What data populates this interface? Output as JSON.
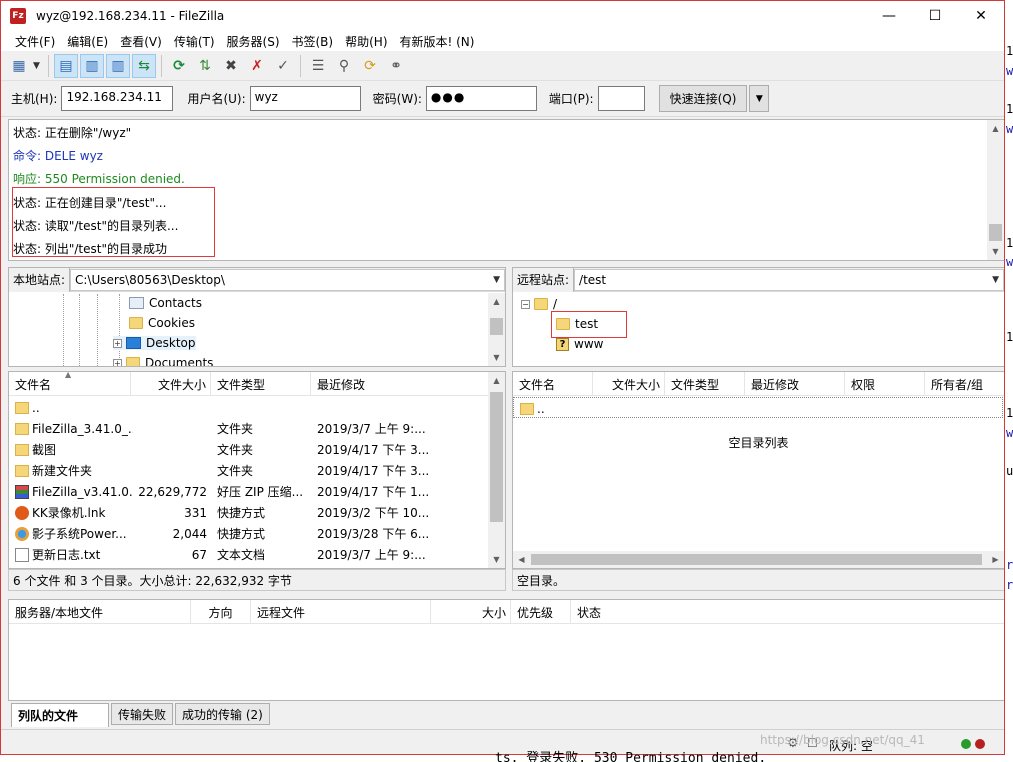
{
  "window": {
    "title": "wyz@192.168.234.11 - FileZilla",
    "app_icon": "Fz"
  },
  "menu": [
    "文件(F)",
    "编辑(E)",
    "查看(V)",
    "传输(T)",
    "服务器(S)",
    "书签(B)",
    "帮助(H)",
    "有新版本! (N)"
  ],
  "quickconnect": {
    "host_label": "主机(H):",
    "host_value": "192.168.234.11",
    "user_label": "用户名(U):",
    "user_value": "wyz",
    "pass_label": "密码(W):",
    "pass_value": "●●●",
    "port_label": "端口(P):",
    "port_value": "",
    "button": "快速连接(Q)"
  },
  "log": [
    {
      "type": "status",
      "text": "状态: 正在删除\"/wyz\""
    },
    {
      "type": "command",
      "text": "命令: DELE wyz"
    },
    {
      "type": "response",
      "text": "响应: 550 Permission denied."
    },
    {
      "type": "status",
      "text": "状态: 正在创建目录\"/test\"..."
    },
    {
      "type": "status",
      "text": "状态: 读取\"/test\"的目录列表..."
    },
    {
      "type": "status",
      "text": "状态: 列出\"/test\"的目录成功"
    }
  ],
  "local": {
    "site_label": "本地站点:",
    "path": "C:\\Users\\80563\\Desktop\\",
    "tree": [
      "Contacts",
      "Cookies",
      "Desktop",
      "Documents"
    ],
    "columns": [
      "文件名",
      "文件大小",
      "文件类型",
      "最近修改"
    ],
    "files": [
      {
        "name": "..",
        "size": "",
        "type": "",
        "modified": "",
        "icon": "folder"
      },
      {
        "name": "FileZilla_3.41.0_...",
        "size": "",
        "type": "文件夹",
        "modified": "2019/3/7 上午 9:...",
        "icon": "folder"
      },
      {
        "name": "截图",
        "size": "",
        "type": "文件夹",
        "modified": "2019/4/17 下午 3...",
        "icon": "folder"
      },
      {
        "name": "新建文件夹",
        "size": "",
        "type": "文件夹",
        "modified": "2019/4/17 下午 3...",
        "icon": "folder"
      },
      {
        "name": "FileZilla_v3.41.0...",
        "size": "22,629,772",
        "type": "好压 ZIP 压缩...",
        "modified": "2019/4/17 下午 1...",
        "icon": "zip"
      },
      {
        "name": "KK录像机.lnk",
        "size": "331",
        "type": "快捷方式",
        "modified": "2019/3/2 下午 10...",
        "icon": "kk"
      },
      {
        "name": "影子系统Power...",
        "size": "2,044",
        "type": "快捷方式",
        "modified": "2019/3/28 下午 6...",
        "icon": "yz"
      },
      {
        "name": "更新日志.txt",
        "size": "67",
        "type": "文本文档",
        "modified": "2019/3/7 上午 9:...",
        "icon": "txt"
      }
    ],
    "status": "6 个文件 和 3 个目录。大小总计: 22,632,932 字节"
  },
  "remote": {
    "site_label": "远程站点:",
    "path": "/test",
    "tree": [
      "/",
      "test",
      "www"
    ],
    "columns": [
      "文件名",
      "文件大小",
      "文件类型",
      "最近修改",
      "权限",
      "所有者/组"
    ],
    "files": [
      {
        "name": ".."
      }
    ],
    "empty_text": "空目录列表",
    "status": "空目录。"
  },
  "queue": {
    "columns": [
      "服务器/本地文件",
      "方向",
      "远程文件",
      "大小",
      "优先级",
      "状态"
    ],
    "tabs": [
      "列队的文件",
      "传输失败",
      "成功的传输 (2)"
    ],
    "status": "队列: 空"
  },
  "behind": {
    "text": "ts. 登录失败. 530 Permission denied.",
    "watermark": "https://blog.csdn.net/qq_41"
  },
  "colors": {
    "accent_red": "#e23a3a",
    "command_blue": "#1f35b8",
    "response_green": "#1e8a1e"
  }
}
